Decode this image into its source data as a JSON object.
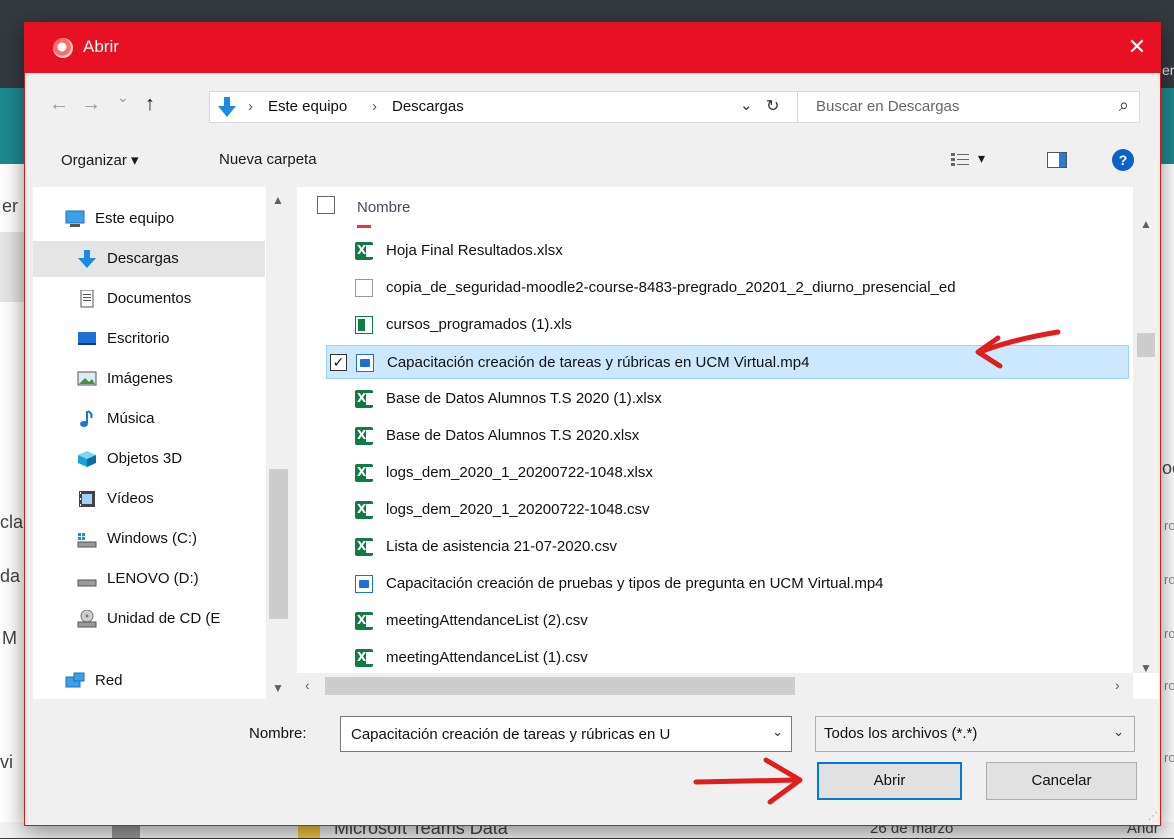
{
  "background": {
    "bottom_item_name": "Microsoft Teams Data",
    "bottom_item_date": "26 de marzo",
    "bottom_item_author": "Andr",
    "left_fragments": [
      "er",
      "cla",
      "da",
      "M",
      "vi"
    ],
    "right_fragments": [
      "er",
      "oc",
      "ro",
      "ro",
      "ro",
      "ro",
      "ro"
    ]
  },
  "dialog": {
    "title": "Abrir",
    "close_glyph": "✕",
    "title_icon": "opera-browser-icon",
    "accent_color": "#e81123"
  },
  "nav": {
    "back_glyph": "←",
    "forward_glyph": "→",
    "recent_glyph": "⌄",
    "up_glyph": "↑",
    "breadcrumb": [
      "Este equipo",
      "Descargas"
    ],
    "breadcrumb_sep": "›",
    "history_glyph": "⌄",
    "refresh_glyph": "↻",
    "search_placeholder": "Buscar en Descargas",
    "search_icon_glyph": "⌕"
  },
  "toolbar": {
    "organize_label": "Organizar ▾",
    "new_folder_label": "Nueva carpeta",
    "view_glyph": "▾",
    "help_glyph": "?"
  },
  "sidebar": {
    "items": [
      {
        "label": "Este equipo",
        "icon": "computer-icon"
      },
      {
        "label": "Descargas",
        "icon": "downloads-icon"
      },
      {
        "label": "Documentos",
        "icon": "documents-icon"
      },
      {
        "label": "Escritorio",
        "icon": "desktop-icon"
      },
      {
        "label": "Imágenes",
        "icon": "pictures-icon"
      },
      {
        "label": "Música",
        "icon": "music-icon"
      },
      {
        "label": "Objetos 3D",
        "icon": "objects-3d-icon"
      },
      {
        "label": "Vídeos",
        "icon": "videos-icon"
      },
      {
        "label": "Windows (C:)",
        "icon": "drive-c-icon"
      },
      {
        "label": "LENOVO (D:)",
        "icon": "drive-d-icon"
      },
      {
        "label": "Unidad de CD (E",
        "icon": "cd-drive-icon"
      },
      {
        "label": "Red",
        "icon": "network-icon"
      }
    ]
  },
  "filelist": {
    "column_name": "Nombre",
    "files": [
      {
        "name": "Hoja Final Resultados.xlsx",
        "type": "xlsx",
        "selected": false
      },
      {
        "name": "copia_de_seguridad-moodle2-course-8483-pregrado_20201_2_diurno_presencial_ed",
        "type": "file",
        "selected": false
      },
      {
        "name": "cursos_programados (1).xls",
        "type": "xls",
        "selected": false
      },
      {
        "name": "Capacitación creación de tareas y rúbricas en UCM Virtual.mp4",
        "type": "mp4",
        "selected": true
      },
      {
        "name": "Base de Datos Alumnos T.S 2020 (1).xlsx",
        "type": "xlsx",
        "selected": false
      },
      {
        "name": "Base de Datos Alumnos T.S 2020.xlsx",
        "type": "xlsx",
        "selected": false
      },
      {
        "name": "logs_dem_2020_1_20200722-1048.xlsx",
        "type": "xlsx",
        "selected": false
      },
      {
        "name": "logs_dem_2020_1_20200722-1048.csv",
        "type": "csv",
        "selected": false
      },
      {
        "name": "Lista de asistencia 21-07-2020.csv",
        "type": "csv",
        "selected": false
      },
      {
        "name": "Capacitación creación de pruebas y tipos de pregunta en UCM Virtual.mp4",
        "type": "mp4",
        "selected": false
      },
      {
        "name": "meetingAttendanceList (2).csv",
        "type": "csv",
        "selected": false
      },
      {
        "name": "meetingAttendanceList (1).csv",
        "type": "csv",
        "selected": false
      }
    ]
  },
  "footer": {
    "filename_label": "Nombre:",
    "filename_value": "Capacitación creación de tareas y rúbricas en U",
    "filetype_value": "Todos los archivos (*.*)",
    "dropdown_glyph": "⌄",
    "open_label": "Abrir",
    "cancel_label": "Cancelar"
  },
  "annotations": {
    "arrow_color": "#e01e1e"
  }
}
